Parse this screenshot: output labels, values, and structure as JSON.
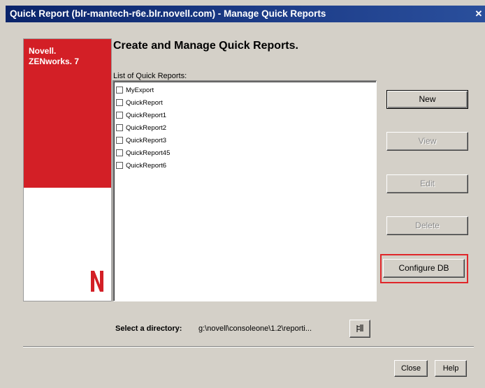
{
  "window": {
    "title": "Quick Report (blr-mantech-r6e.blr.novell.com) - Manage Quick Reports",
    "close_glyph": "✕"
  },
  "brand": {
    "line1": "Novell.",
    "line2": "ZENworks. 7",
    "logo_icon": "novell-n-logo",
    "red": "#d31f26"
  },
  "page_title": "Create and Manage Quick Reports.",
  "list": {
    "label": "List of Quick Reports:",
    "items": [
      {
        "label": "MyExport",
        "checked": false
      },
      {
        "label": "QuickReport",
        "checked": false
      },
      {
        "label": "QuickReport1",
        "checked": false
      },
      {
        "label": "QuickReport2",
        "checked": false
      },
      {
        "label": "QuickReport3",
        "checked": false
      },
      {
        "label": "QuickReport45",
        "checked": false
      },
      {
        "label": "QuickReport6",
        "checked": false
      }
    ]
  },
  "buttons": {
    "new": "New",
    "view": "View",
    "edit": "Edit",
    "delete": "Delete",
    "configure_db": "Configure DB",
    "close": "Close",
    "help": "Help"
  },
  "directory": {
    "label": "Select a directory:",
    "path": "g:\\novell\\consoleone\\1.2\\reporti...",
    "browse_icon": "folder-tree-icon"
  },
  "colors": {
    "title_bar": "#0a246a",
    "dialog_bg": "#d4d0c8",
    "highlight": "#e0262a"
  }
}
